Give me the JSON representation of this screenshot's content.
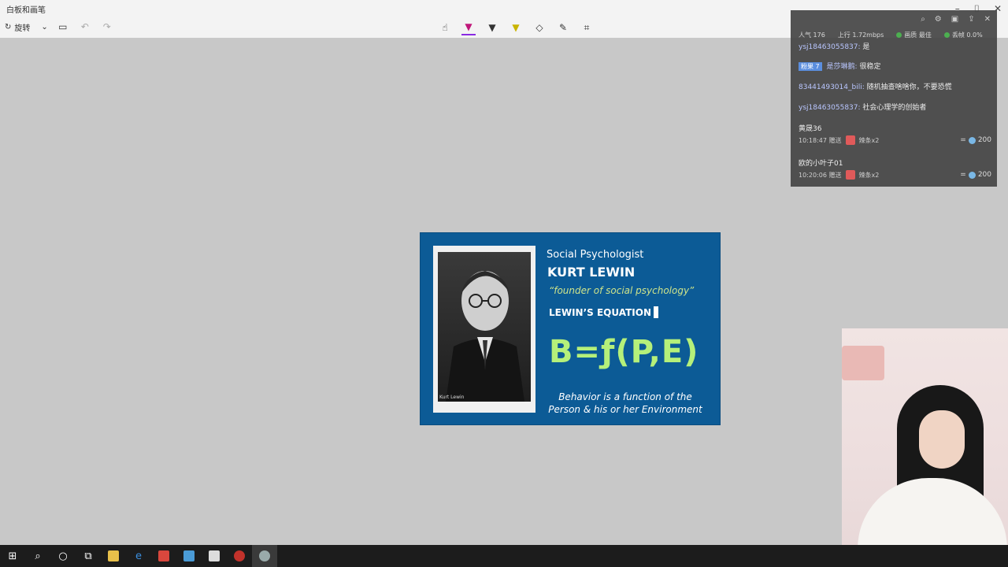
{
  "window": {
    "title": "白板和画笔",
    "controls": [
      "–",
      "⌷",
      "✕"
    ]
  },
  "toolbar": {
    "rotate_label": "旋转",
    "left_icons": [
      "undo-icon",
      "redo-icon"
    ],
    "center_tools": [
      "touch-write-icon",
      "pen-icon",
      "calligraphy-icon",
      "highlighter-icon",
      "eraser-icon",
      "ruler-icon",
      "crop-icon"
    ]
  },
  "slide": {
    "subtitle": "Social Psychologist",
    "name": "KURT LEWIN",
    "quote": "“founder of social psychology”",
    "equation_label": "LEWIN’S EQUATION",
    "equation": "B=ƒ(P,E)",
    "desc_line1": "Behavior is a function of the",
    "desc_line2": "Person & his or her Environment",
    "photo_caption": "Kurt Lewin"
  },
  "chat": {
    "stats": {
      "viewers": "人气 176",
      "upload": "上行 1.72mbps",
      "quality": "画质 最佳",
      "drop": "丢帧 0.0%"
    },
    "messages": [
      {
        "user": "ysj18463055837:",
        "text": "是"
      },
      {
        "badge": "粉果 7",
        "user": "是莎琳鹅:",
        "text": "很稳定"
      },
      {
        "user": "83441493014_bili:",
        "text": "随机抽查啥啥你，不要恐慌"
      },
      {
        "user": "ysj18463055837:",
        "text": "社会心理学的创始者"
      }
    ],
    "gifts": [
      {
        "name": "黄晟36",
        "time": "10:18:47",
        "action": "赠送",
        "item": "辣条x2",
        "amount": "200"
      },
      {
        "name": "欧的小叶子01",
        "time": "10:20:06",
        "action": "赠送",
        "item": "辣条x2",
        "amount": "200"
      }
    ]
  },
  "taskbar": {
    "items": [
      "start-icon",
      "search-icon",
      "cortana-icon",
      "task-view-icon",
      "file-explorer-icon",
      "edge-icon",
      "app-red-icon",
      "app-blue-icon",
      "photos-icon",
      "app-circle-icon",
      "app-current-icon"
    ]
  },
  "colors": {
    "slide_bg": "#0c5b96",
    "equation": "#b5f07a",
    "quote": "#cfe48a"
  }
}
